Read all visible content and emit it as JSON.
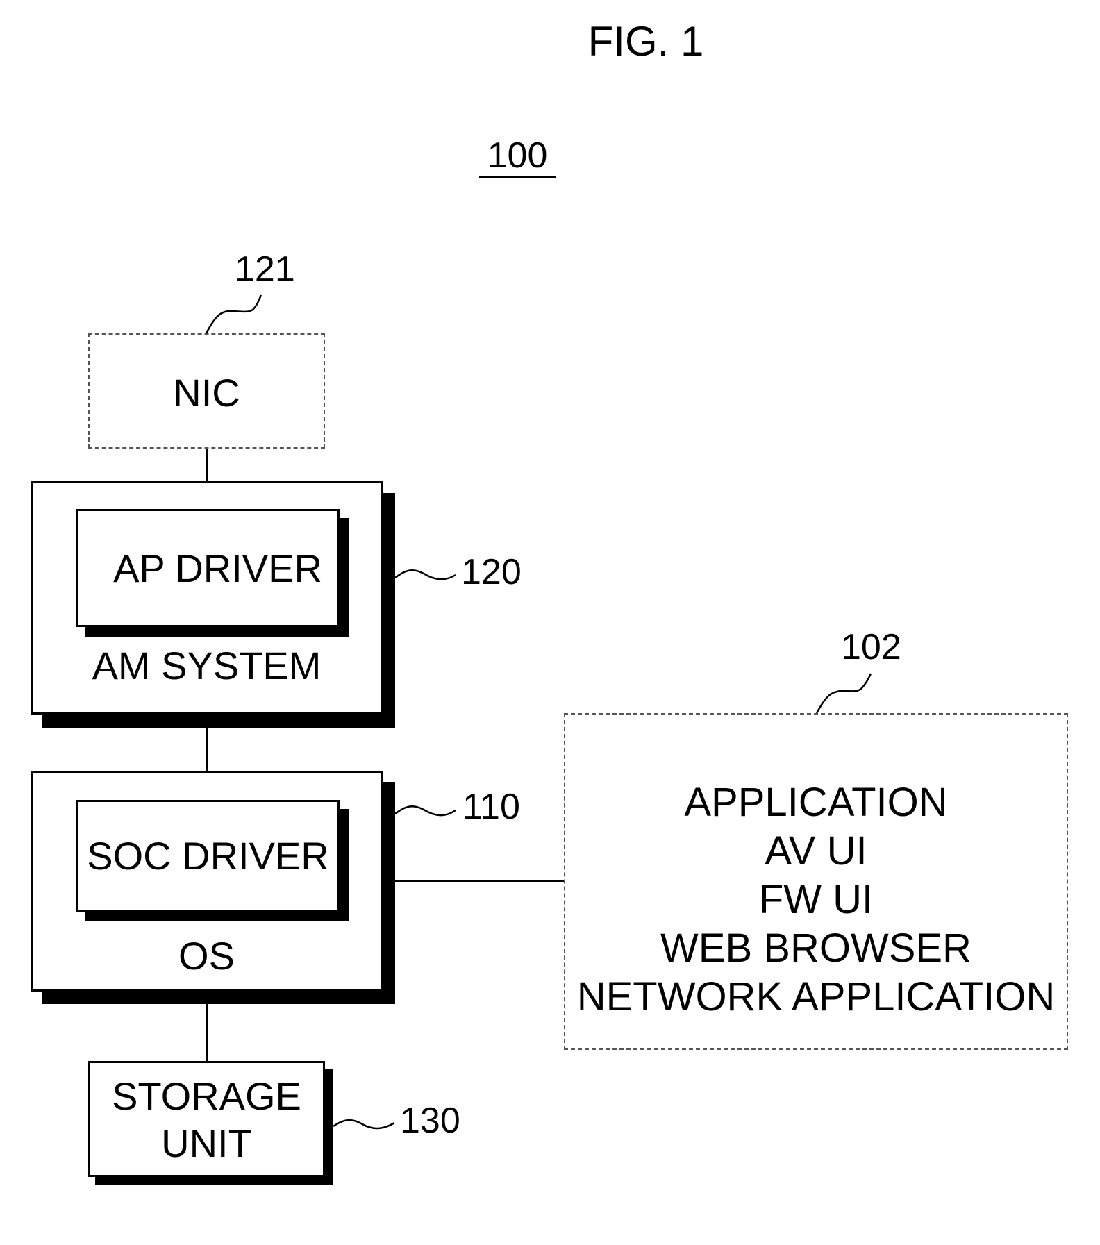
{
  "figure": {
    "title": "FIG. 1",
    "system_ref": "100"
  },
  "nic": {
    "label": "NIC",
    "ref": "121"
  },
  "am_system": {
    "label": "AM SYSTEM",
    "ref": "120",
    "inner": {
      "label": "AP DRIVER"
    }
  },
  "os": {
    "label": "OS",
    "ref": "110",
    "inner": {
      "label": "SOC DRIVER"
    }
  },
  "storage": {
    "label_line1": "STORAGE",
    "label_line2": "UNIT",
    "ref": "130"
  },
  "application_box": {
    "ref": "102",
    "items": [
      "APPLICATION",
      "AV UI",
      "FW UI",
      "WEB BROWSER",
      "NETWORK APPLICATION"
    ]
  }
}
